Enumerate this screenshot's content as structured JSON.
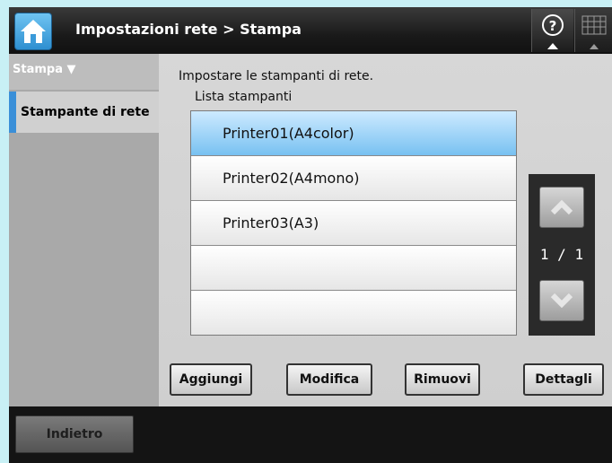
{
  "header": {
    "title": "Impostazioni rete > Stampa",
    "home_icon": "home-icon",
    "help_icon": "help-icon",
    "keyboard_icon": "keyboard-icon",
    "accent_color": "#3a8fd8"
  },
  "sidebar": {
    "section_label": "Stampa ▼",
    "items": [
      {
        "label": "Stampante di rete",
        "selected": true
      }
    ]
  },
  "main": {
    "instructions": "Impostare le stampanti di rete.",
    "list_label": "Lista stampanti",
    "printers": [
      {
        "name": "Printer01(A4color)",
        "selected": true
      },
      {
        "name": "Printer02(A4mono)",
        "selected": false
      },
      {
        "name": "Printer03(A3)",
        "selected": false
      },
      {
        "name": "",
        "selected": false
      },
      {
        "name": "",
        "selected": false
      }
    ],
    "pager": {
      "indicator": "1 / 1"
    },
    "buttons": {
      "add": "Aggiungi",
      "edit": "Modifica",
      "remove": "Rimuovi",
      "details": "Dettagli"
    }
  },
  "footer": {
    "back_label": "Indietro"
  }
}
